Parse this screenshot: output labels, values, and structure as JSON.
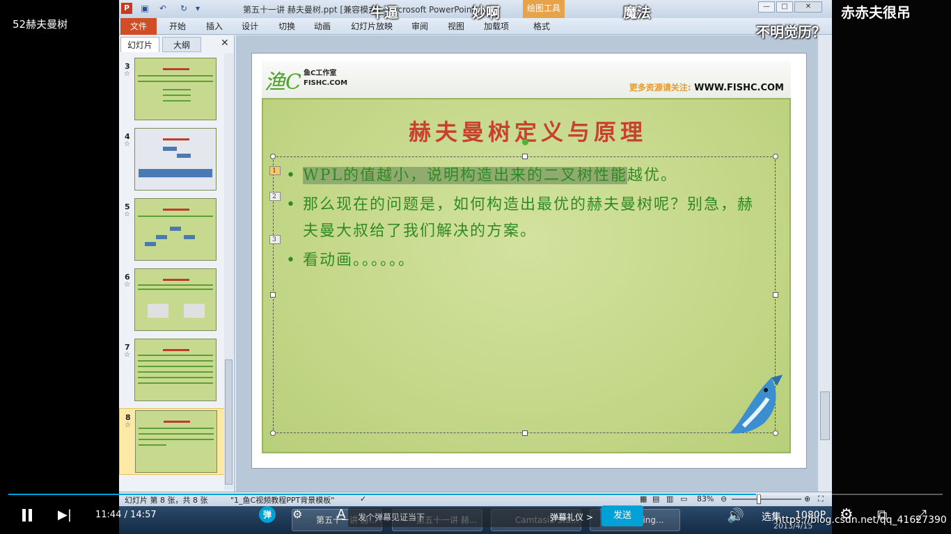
{
  "video": {
    "title": "52赫夫曼树",
    "help": "?"
  },
  "window": {
    "title": "第五十一讲 赫夫曼树.ppt [兼容模式] - Microsoft PowerPoint",
    "context_tab": "绘图工具",
    "min": "—",
    "max": "□",
    "close": "✕",
    "app_logo": "P"
  },
  "ribbon": {
    "file": "文件",
    "tabs": [
      "开始",
      "插入",
      "设计",
      "切换",
      "动画",
      "幻灯片放映",
      "审阅",
      "视图",
      "加载项",
      "格式"
    ]
  },
  "left_panel": {
    "tab_slides": "幻灯片",
    "tab_outline": "大纲",
    "close": "✕",
    "thumbnails": [
      {
        "num": "3",
        "star": "☆"
      },
      {
        "num": "4",
        "star": "☆"
      },
      {
        "num": "5",
        "star": "☆"
      },
      {
        "num": "6",
        "star": "☆"
      },
      {
        "num": "7",
        "star": "☆"
      },
      {
        "num": "8",
        "star": "☆"
      }
    ]
  },
  "slide": {
    "logo_mark": "渔C",
    "logo_name": "鱼C工作室",
    "logo_site": "FISHC.COM",
    "site_prefix": "更多资源请关注:",
    "site_url": "WWW.FISHC.COM",
    "title": "赫夫曼树定义与原理",
    "bullets": [
      {
        "tag": "1",
        "highlight": "WPL的值越小，说明构造出来的二叉树性能",
        "rest": "越优。"
      },
      {
        "tag": "2",
        "text": "那么现在的问题是，如何构造出最优的赫夫曼树呢？别急，赫夫曼大叔给了我们解决的方案。"
      },
      {
        "tag": "3",
        "text": "看动画。。。。。。"
      }
    ]
  },
  "status": {
    "slide_info": "幻灯片 第 8 张，共 8 张",
    "theme": "\"1_鱼C视频教程PPT背景模板\"",
    "zoom": "83%"
  },
  "danmaku": [
    {
      "text": "牛逼"
    },
    {
      "text": "妙啊"
    },
    {
      "text": "魔法"
    },
    {
      "text": "赤赤夫很吊"
    },
    {
      "text": "不明觉历？"
    }
  ],
  "taskbar": {
    "items": [
      "第五十一讲 赫...",
      "第五十一讲 赫...",
      "Camtasia Stu...",
      "Recording..."
    ],
    "date": "2013/4/15"
  },
  "player": {
    "progress": 0.8,
    "time_current": "11:44",
    "time_sep": "/",
    "time_total": "14:57",
    "danmaku_toggle": "弹",
    "danmaku_placeholder": "发个弹幕见证当下",
    "gift": "弹幕礼仪 >",
    "send": "发送",
    "select": "选集",
    "quality": "1080P",
    "watermark": "https://blog.csdn.net/qq_41627390"
  }
}
